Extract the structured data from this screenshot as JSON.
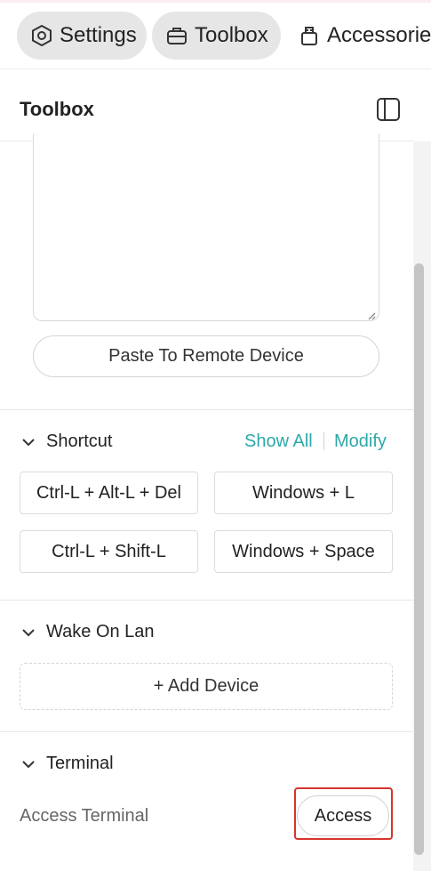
{
  "tabs": [
    {
      "label": "Settings",
      "icon": "gear-hex-icon",
      "active": false
    },
    {
      "label": "Toolbox",
      "icon": "toolbox-icon",
      "active": true
    },
    {
      "label": "Accessories",
      "icon": "accessory-icon",
      "active": false
    }
  ],
  "panel": {
    "title": "Toolbox",
    "toggle_icon": "sidebar-panel-icon"
  },
  "clipboard": {
    "textarea_value": "",
    "paste_label": "Paste To Remote Device"
  },
  "shortcut": {
    "title": "Shortcut",
    "show_all": "Show All",
    "modify": "Modify",
    "buttons": [
      "Ctrl-L + Alt-L + Del",
      "Windows + L",
      "Ctrl-L + Shift-L",
      "Windows + Space"
    ]
  },
  "wake_on_lan": {
    "title": "Wake On Lan",
    "add_label": "+ Add Device"
  },
  "terminal": {
    "title": "Terminal",
    "row_label": "Access Terminal",
    "access_label": "Access"
  },
  "colors": {
    "accent": "#2ea8a8",
    "highlight": "#d9342b",
    "pill": "#e6e6e6"
  }
}
